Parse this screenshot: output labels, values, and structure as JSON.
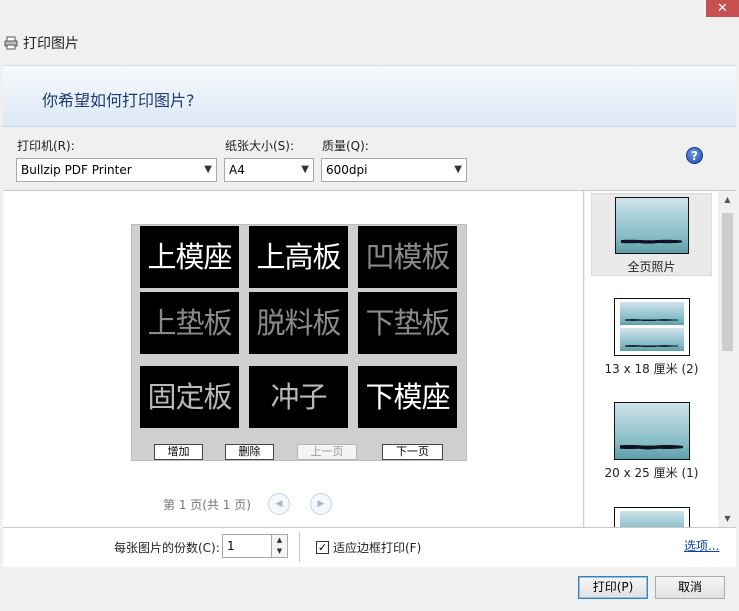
{
  "window": {
    "title": "打印图片",
    "close_glyph": "✕"
  },
  "header": {
    "prompt": "你希望如何打印图片?"
  },
  "options": {
    "printer": {
      "label": "打印机(R):",
      "value": "Bullzip PDF Printer"
    },
    "paper_size": {
      "label": "纸张大小(S):",
      "value": "A4"
    },
    "quality": {
      "label": "质量(Q):",
      "value": "600dpi"
    },
    "help_glyph": "?"
  },
  "preview": {
    "tiles": [
      "上模座",
      "上高板",
      "凹模板",
      "上垫板",
      "脱料板",
      "下垫板",
      "固定板",
      "冲子",
      "下模座"
    ],
    "buttons": {
      "add": "增加",
      "delete": "删除",
      "prev_page": "上一页",
      "next_page": "下一页"
    },
    "page_indicator": "第 1 页(共 1 页)",
    "nav_prev_glyph": "◀",
    "nav_next_glyph": "▶"
  },
  "layouts": [
    {
      "label": "全页照片",
      "selected": true
    },
    {
      "label": "13 x 18 厘米 (2)",
      "selected": false
    },
    {
      "label": "20 x 25 厘米 (1)",
      "selected": false
    },
    {
      "label": "",
      "selected": false
    }
  ],
  "scrollbar": {
    "up_glyph": "▲",
    "down_glyph": "▼"
  },
  "footer": {
    "copies_label": "每张图片的份数(C):",
    "copies_value": "1",
    "spin_up_glyph": "▲",
    "spin_down_glyph": "▼",
    "fit_frame_checked_glyph": "✓",
    "fit_frame_label": "适应边框打印(F)",
    "options_link": "选项..."
  },
  "actions": {
    "print": "打印(P)",
    "cancel": "取消"
  },
  "icons": {
    "window_icon": "printer-icon"
  },
  "colors": {
    "header_text": "#1e3b73",
    "link": "#0645ad",
    "close_button": "#c75050"
  }
}
